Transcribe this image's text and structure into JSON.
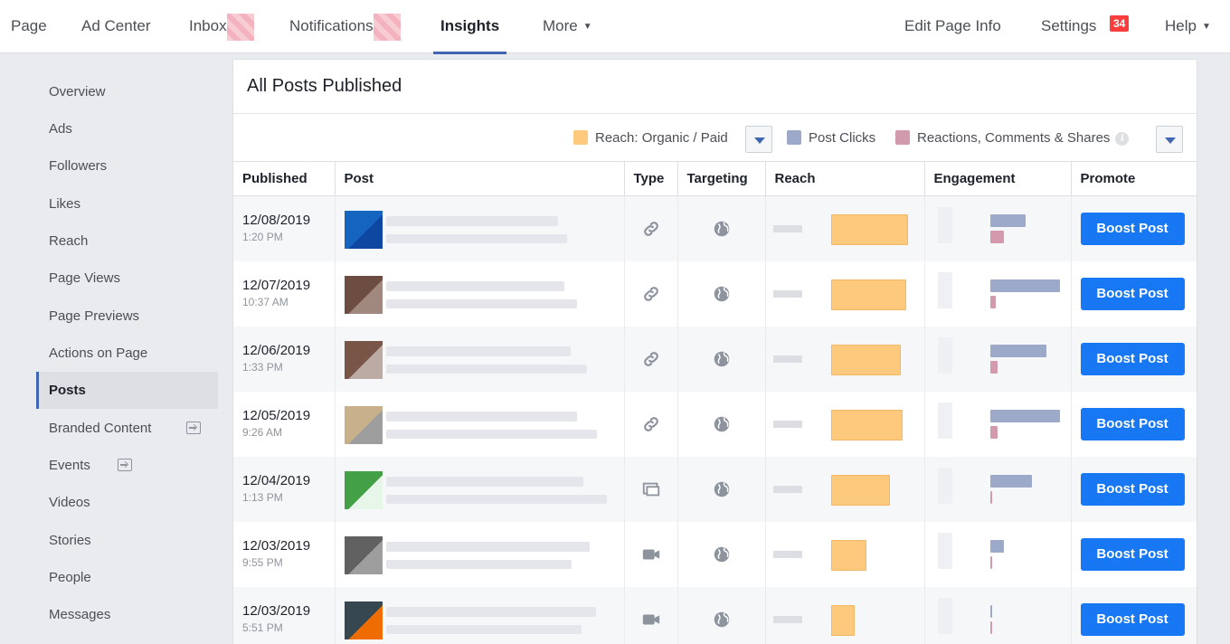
{
  "topnav": {
    "left": [
      {
        "label": "Page"
      },
      {
        "label": "Ad Center"
      },
      {
        "label": "Inbox"
      },
      {
        "label": "Notifications"
      },
      {
        "label": "Insights"
      },
      {
        "label": "More"
      }
    ],
    "right": [
      {
        "label": "Edit Page Info"
      },
      {
        "label": "Settings",
        "badge": "34"
      },
      {
        "label": "Help"
      }
    ]
  },
  "sidebar": {
    "items": [
      {
        "label": "Overview"
      },
      {
        "label": "Ads"
      },
      {
        "label": "Followers"
      },
      {
        "label": "Likes"
      },
      {
        "label": "Reach"
      },
      {
        "label": "Page Views"
      },
      {
        "label": "Page Previews"
      },
      {
        "label": "Actions on Page"
      },
      {
        "label": "Posts"
      },
      {
        "label": "Branded Content"
      },
      {
        "label": "Events"
      },
      {
        "label": "Videos"
      },
      {
        "label": "Stories"
      },
      {
        "label": "People"
      },
      {
        "label": "Messages"
      }
    ],
    "active": "Posts"
  },
  "panel": {
    "title": "All Posts Published",
    "legend": {
      "reach": "Reach: Organic / Paid",
      "clicks": "Post Clicks",
      "reactions": "Reactions, Comments & Shares"
    },
    "columns": [
      "Published",
      "Post",
      "Type",
      "Targeting",
      "Reach",
      "Engagement",
      "Promote"
    ],
    "boost_label": "Boost Post"
  },
  "colors": {
    "reach": "#fdc97d",
    "clicks": "#9ca9c9",
    "reactions": "#d29aac",
    "boost": "#1877f2",
    "accent": "#4267b2"
  },
  "posts": [
    {
      "date": "12/08/2019",
      "time": "1:20 PM",
      "type": "link-icon",
      "reach": 1.0,
      "clicks": 0.5,
      "reactions": 0.2
    },
    {
      "date": "12/07/2019",
      "time": "10:37 AM",
      "type": "link-icon",
      "reach": 0.98,
      "clicks": 1.0,
      "reactions": 0.08
    },
    {
      "date": "12/06/2019",
      "time": "1:33 PM",
      "type": "link-icon",
      "reach": 0.9,
      "clicks": 0.8,
      "reactions": 0.1
    },
    {
      "date": "12/05/2019",
      "time": "9:26 AM",
      "type": "link-icon",
      "reach": 0.93,
      "clicks": 1.0,
      "reactions": 0.1
    },
    {
      "date": "12/04/2019",
      "time": "1:13 PM",
      "type": "album-icon",
      "reach": 0.77,
      "clicks": 0.6,
      "reactions": 0.02
    },
    {
      "date": "12/03/2019",
      "time": "9:55 PM",
      "type": "video-icon",
      "reach": 0.46,
      "clicks": 0.2,
      "reactions": 0.02
    },
    {
      "date": "12/03/2019",
      "time": "5:51 PM",
      "type": "video-icon",
      "reach": 0.3,
      "clicks": 0.02,
      "reactions": 0.02
    }
  ]
}
